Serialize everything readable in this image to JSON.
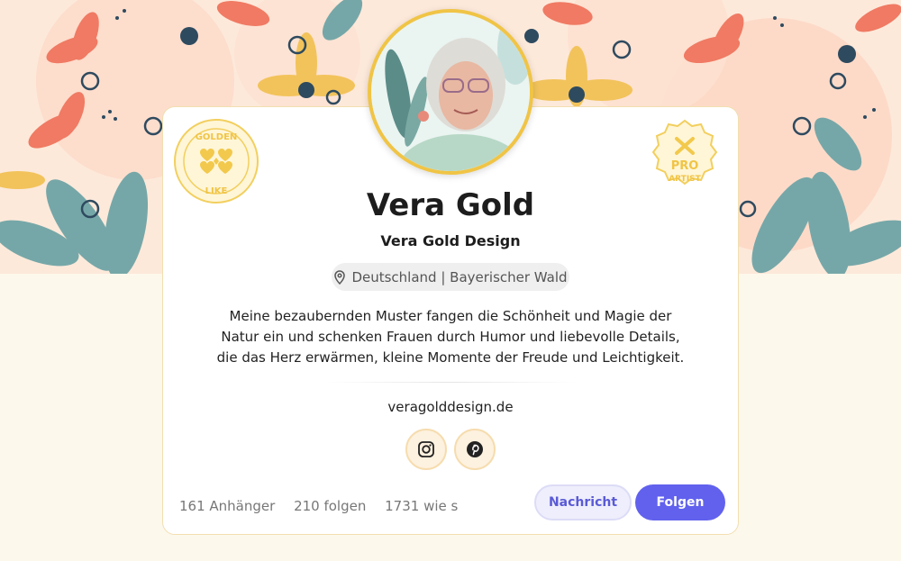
{
  "profile": {
    "name": "Vera Gold",
    "company": "Vera Gold Design",
    "location": "Deutschland | Bayerischer Wald",
    "bio_lines": [
      "Meine bezaubernden Muster fangen die Schönheit und Magie der",
      "Natur ein und schenken Frauen durch Humor und liebevolle Details,",
      "die das Herz erwärmen, kleine Momente der Freude und Leichtigkeit."
    ],
    "website": "veragolddesign.de"
  },
  "badges": {
    "golden_like": {
      "top": "GOLDEN",
      "bottom": "LIKE"
    },
    "pro_artist": {
      "line1": "PRO",
      "line2": "ARTIST"
    }
  },
  "social": {
    "instagram_icon": "instagram-icon",
    "pinterest_icon": "pinterest-icon"
  },
  "stats": {
    "followers": "161 Anhänger",
    "following": "210 folgen",
    "likes": "1731 wie s"
  },
  "actions": {
    "message_label": "Nachricht",
    "follow_label": "Folgen"
  },
  "colors": {
    "accent": "#6161ee",
    "gold": "#f0c445",
    "banner_bg": "#fde9da"
  }
}
